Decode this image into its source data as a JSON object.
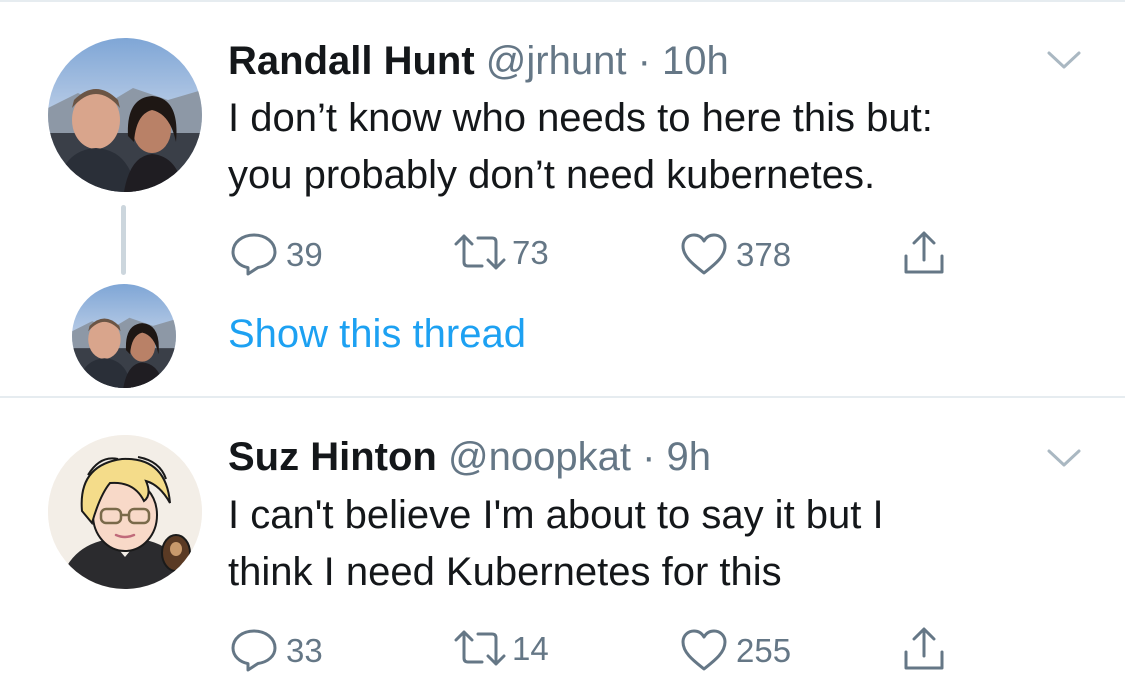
{
  "tweets": [
    {
      "display_name": "Randall Hunt",
      "handle": "@jrhunt",
      "separator": "·",
      "timestamp": "10h",
      "text_lines": [
        "I don’t know who needs to here this but:",
        "you probably don’t need kubernetes."
      ],
      "replies": "39",
      "retweets": "73",
      "likes": "378",
      "avatar_icon": "couple-photo-avatar"
    },
    {
      "display_name": "Suz Hinton",
      "handle": "@noopkat",
      "separator": "·",
      "timestamp": "9h",
      "text_lines": [
        "I can't believe I'm about to say it but I",
        "think I need Kubernetes for this"
      ],
      "replies": "33",
      "retweets": "14",
      "likes": "255",
      "avatar_icon": "illustrated-avatar"
    }
  ],
  "thread": {
    "show_thread_label": "Show this thread"
  },
  "colors": {
    "link": "#1da1f2",
    "secondary_text": "#657786",
    "primary_text": "#14171a",
    "divider": "#e6ecf0",
    "thread_line": "#ccd6dd"
  }
}
